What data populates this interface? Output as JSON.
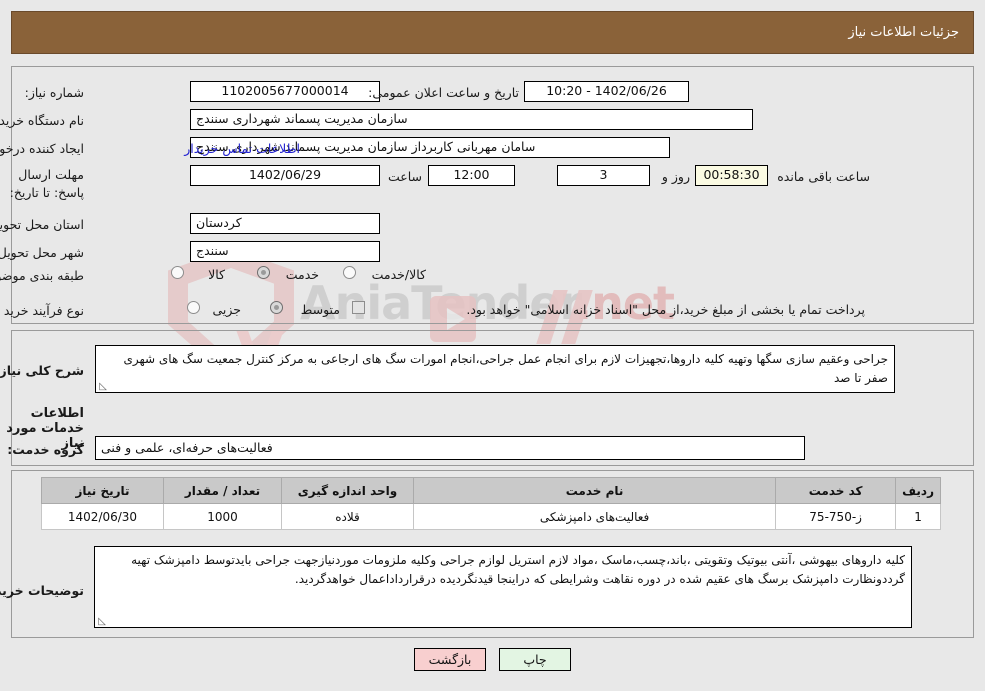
{
  "header": {
    "title": "جزئیات اطلاعات نیاز"
  },
  "form": {
    "need_number": {
      "label": "شماره نیاز:",
      "value": "1102005677000014"
    },
    "public_announce": {
      "label": "تاریخ و ساعت اعلان عمومی:",
      "value": "1402/06/26 - 10:20"
    },
    "buyer_org": {
      "label": "نام دستگاه خریدار:",
      "value": "سازمان مدیریت پسماند شهرداری سنندج"
    },
    "requester": {
      "label": "ایجاد کننده درخواست:",
      "value": "سامان مهربانی کاربرداز سازمان مدیریت پسماند شهرداری سنندج"
    },
    "contact_link": {
      "label": "اطلاعات تماس خریدار"
    },
    "deadline": {
      "label": "مهلت ارسال پاسخ: تا تاریخ:",
      "date": "1402/06/29",
      "hour_label": "ساعت",
      "hour": "12:00",
      "days": "3",
      "days_suffix": "روز و",
      "countdown": "00:58:30",
      "countdown_suffix": "ساعت باقی مانده"
    },
    "province": {
      "label": "استان محل تحویل:",
      "value": "کردستان"
    },
    "city": {
      "label": "شهر محل تحویل:",
      "value": "سنندج"
    },
    "category": {
      "label": "طبقه بندی موضوعی:",
      "options": [
        "کالا",
        "خدمت",
        "کالا/خدمت"
      ],
      "selected": "خدمت"
    },
    "purchase_process": {
      "label": "نوع فرآیند خرید :",
      "options": [
        "جزیی",
        "متوسط"
      ],
      "selected": "متوسط",
      "checkbox_label": "پرداخت تمام یا بخشی از مبلغ خرید،از محل \"اسناد خزانه اسلامی\" خواهد بود.",
      "checkbox_checked": false
    }
  },
  "summary": {
    "label": "شرح کلی نیاز:",
    "value": "جراحی وعقیم سازی سگها وتهیه کلیه داروها،تجهیزات لازم برای انجام عمل جراحی،انجام امورات سگ های ارجاعی به مرکز کنترل جمعیت سگ های شهری صفر تا صد"
  },
  "services_section": {
    "heading": "اطلاعات خدمات مورد نیاز",
    "group_label": "گروه خدمت:",
    "group_value": "فعالیت‌های حرفه‌ای، علمی و فنی"
  },
  "table": {
    "columns": [
      "ردیف",
      "کد خدمت",
      "نام خدمت",
      "واحد اندازه گیری",
      "تعداد / مقدار",
      "تاریخ نیاز"
    ],
    "rows": [
      [
        "1",
        "ز-750-75",
        "فعالیت‌های دامپزشکی",
        "قلاده",
        "1000",
        "1402/06/30"
      ]
    ]
  },
  "buyer_notes": {
    "label": "توضیحات خریدار:",
    "value": "کلیه داروهای بیهوشی ،آنتی بیوتیک وتقویتی ،باند،چسب،ماسک ،مواد لازم استریل لوازم جراحی وکلیه ملزومات موردنیازجهت جراحی بایدتوسط دامپزشک تهیه گرددونظارت دامپزشک برسگ های عقیم شده در دوره نقاهت وشرایطی که دراینجا قیدنگردیده درقرارداداعمال خواهدگردید."
  },
  "buttons": {
    "print": "چاپ",
    "return": "بازگشت"
  },
  "watermark": {
    "text_left": "Ania",
    "text_right": "Tender",
    "text_tld": ".net"
  },
  "colors": {
    "header_bg": "#8a6239",
    "link": "#2323d0",
    "return_btn": "#f8cfcf",
    "print_btn": "#e3f5e3",
    "table_header": "#c9c9c9"
  }
}
